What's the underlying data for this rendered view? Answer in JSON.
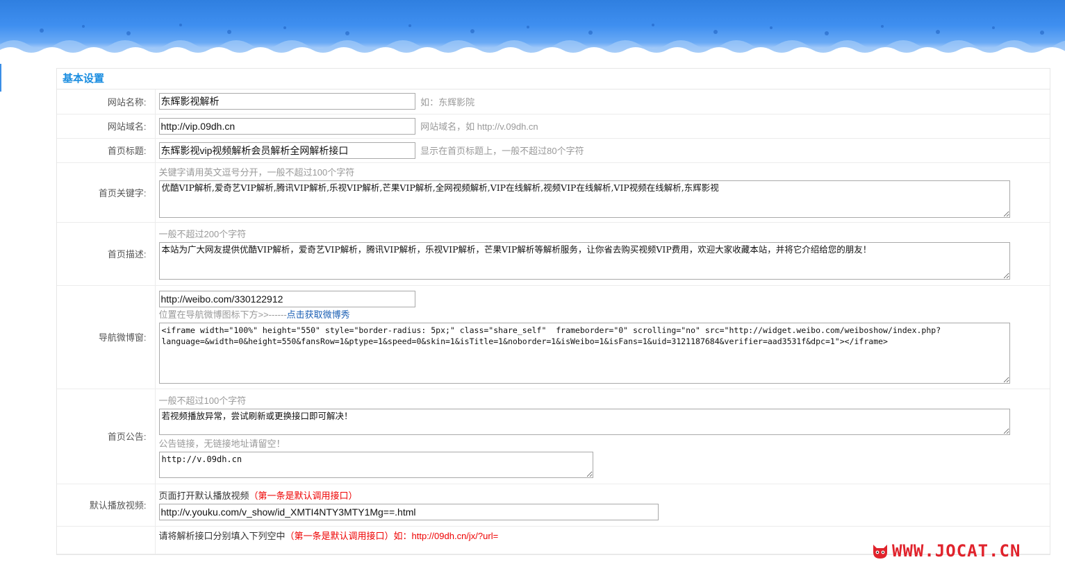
{
  "section_title": "基本设置",
  "site_name": {
    "label": "网站名称:",
    "value": "东辉影视解析",
    "hint": "如：东辉影院"
  },
  "site_domain": {
    "label": "网站域名:",
    "value": "http://vip.09dh.cn",
    "hint": "网站域名，如 http://v.09dh.cn"
  },
  "home_title": {
    "label": "首页标题:",
    "value": "东辉影视vip视频解析会员解析全网解析接口",
    "hint": "显示在首页标题上，一般不超过80个字符"
  },
  "home_keywords": {
    "label": "首页关键字:",
    "tip": "关键字请用英文逗号分开，一般不超过100个字符",
    "value": "优酷VIP解析,爱奇艺VIP解析,腾讯VIP解析,乐视VIP解析,芒果VIP解析,全网视频解析,VIP在线解析,视频VIP在线解析,VIP视频在线解析,东辉影视"
  },
  "home_description": {
    "label": "首页描述:",
    "tip": "一般不超过200个字符",
    "value": "本站为广大网友提供优酷VIP解析，爱奇艺VIP解析，腾讯VIP解析，乐视VIP解析，芒果VIP解析等解析服务，让你省去购买视频VIP费用，欢迎大家收藏本站，并将它介绍给您的朋友！"
  },
  "weibo": {
    "label": "导航微博窗:",
    "url": "http://weibo.com/330122912",
    "tip": "位置在导航微博图标下方>>------",
    "tip_link": "点击获取微博秀",
    "code": "<iframe width=\"100%\" height=\"550\" style=\"border-radius: 5px;\" class=\"share_self\"  frameborder=\"0\" scrolling=\"no\" src=\"http://widget.weibo.com/weiboshow/index.php?language=&width=0&height=550&fansRow=1&ptype=1&speed=0&skin=1&isTitle=1&noborder=1&isWeibo=1&isFans=1&uid=3121187684&verifier=aad3531f&dpc=1\"></iframe>"
  },
  "notice": {
    "label": "首页公告:",
    "tip": "一般不超过100个字符",
    "value": "若视频播放异常，尝试刷新或更换接口即可解决！",
    "link_tip": "公告链接，无链接地址请留空！",
    "link_value": "http://v.09dh.cn"
  },
  "default_video": {
    "label": "默认播放视频:",
    "tip": "页面打开默认播放视频",
    "tip_red": "（第一条是默认调用接口）",
    "value": "http://v.youku.com/v_show/id_XMTI4NTY3MTY1Mg==.html"
  },
  "api": {
    "tip": "请将解析接口分别填入下列空中",
    "tip_red": "（第一条是默认调用接口）如：http://09dh.cn/jx/?url="
  },
  "watermark": {
    "text": "WWW.JOCAT.CN",
    "icon": "cat-icon",
    "color": "#e0232c"
  },
  "colors": {
    "accent": "#1a8de0",
    "banner": "#3f8ff0",
    "warning": "#e00000"
  }
}
